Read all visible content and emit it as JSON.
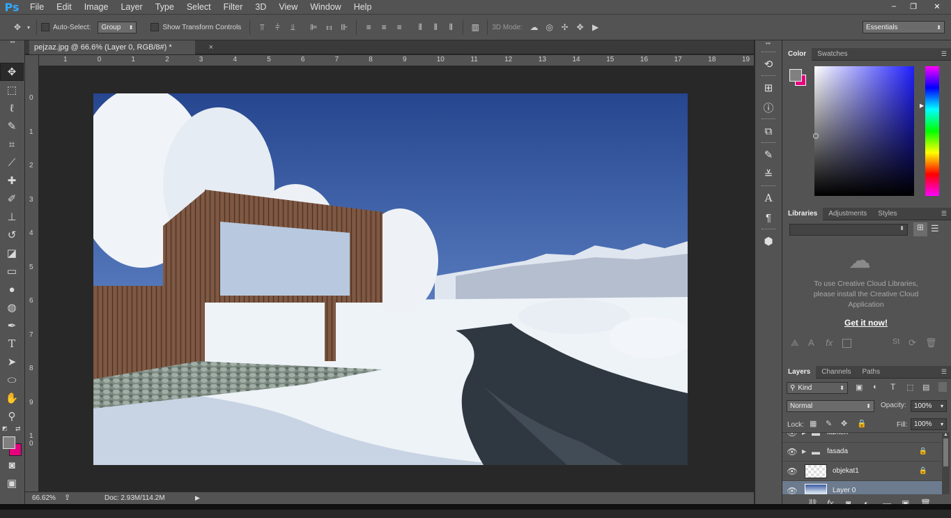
{
  "app": {
    "logo": "Ps",
    "menus": [
      "File",
      "Edit",
      "Image",
      "Layer",
      "Type",
      "Select",
      "Filter",
      "3D",
      "View",
      "Window",
      "Help"
    ],
    "window_controls": [
      "–",
      "❐",
      "✕"
    ]
  },
  "options": {
    "auto_select_label": "Auto-Select:",
    "auto_select_value": "Group",
    "show_transform_label": "Show Transform Controls",
    "mode_3d_label": "3D Mode:",
    "workspace": "Essentials"
  },
  "document": {
    "tab_title": "pejzaz.jpg @ 66.6% (Layer 0, RGB/8#) *",
    "close": "×"
  },
  "rulers": {
    "h": [
      "1",
      "0",
      "1",
      "2",
      "3",
      "4",
      "5",
      "6",
      "7",
      "8",
      "9",
      "10",
      "11",
      "12",
      "13",
      "14",
      "15",
      "16",
      "17",
      "18",
      "19"
    ],
    "v": [
      "0",
      "1",
      "2",
      "3",
      "4",
      "5",
      "6",
      "7",
      "8",
      "9",
      "1 0"
    ]
  },
  "status": {
    "zoom": "66.62%",
    "doc": "Doc: 2.93M/114.2M"
  },
  "color_panel": {
    "tabs": [
      "Color",
      "Swatches"
    ],
    "fg": "#808080",
    "bg": "#e6007e"
  },
  "libraries_panel": {
    "tabs": [
      "Libraries",
      "Adjustments",
      "Styles"
    ],
    "message": "To use Creative Cloud Libraries, please install the Creative Cloud Application",
    "link": "Get it now!"
  },
  "layers_panel": {
    "tabs": [
      "Layers",
      "Channels",
      "Paths"
    ],
    "filter": "Kind",
    "blend": "Normal",
    "opacity_label": "Opacity:",
    "opacity": "100%",
    "lock_label": "Lock:",
    "fill_label": "Fill:",
    "fill": "100%",
    "layers": [
      {
        "name": "kamen",
        "type": "group"
      },
      {
        "name": "fasada",
        "type": "group"
      },
      {
        "name": "objekat1",
        "type": "layer"
      },
      {
        "name": "Layer 0",
        "type": "image"
      }
    ]
  }
}
